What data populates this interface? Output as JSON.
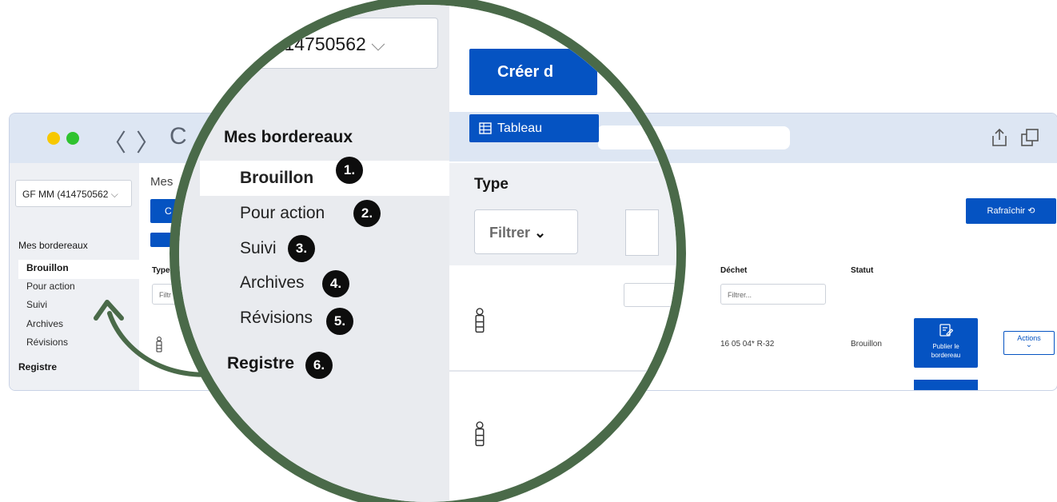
{
  "browser": {
    "nav_back": "〈",
    "nav_forward": "〉",
    "nav_reload": "C"
  },
  "small": {
    "org_select": "GF MM (414750562",
    "sidebar_heading": "Mes bordereaux",
    "items": [
      "Brouillon",
      "Pour action",
      "Suivi",
      "Archives",
      "Révisions"
    ],
    "registre": "Registre",
    "main_heading_fragment": "Mes",
    "create_fragment": "C",
    "type_fragment": "Type",
    "filter_fragment": "Filtr",
    "col_dechet": "Déchet",
    "col_statut": "Statut",
    "filter_placeholder": "Filtrer...",
    "refresh": "Rafraîchir",
    "row1": {
      "dechet": "16 05 04* R-32",
      "statut": "Brouillon"
    },
    "publish_label": "Publier le bordereau",
    "actions_label": "Actions"
  },
  "zoom": {
    "org_select": "(414750562",
    "sidebar_heading": "Mes bordereaux",
    "items": [
      {
        "label": "Brouillon",
        "badge": "1."
      },
      {
        "label": "Pour action",
        "badge": "2."
      },
      {
        "label": "Suivi",
        "badge": "3."
      },
      {
        "label": "Archives",
        "badge": "4."
      },
      {
        "label": "Révisions",
        "badge": "5."
      }
    ],
    "registre": {
      "label": "Registre",
      "badge": "6."
    },
    "create_fragment": "Créer d",
    "tab_tableau": "Tableau",
    "type_label": "Type",
    "filter_button": "Filtrer"
  },
  "colors": {
    "primary_blue": "#0553c2",
    "lens_ring": "#4a6a49",
    "titlebar": "#dde6f3",
    "sidebar": "#eef0f4"
  }
}
